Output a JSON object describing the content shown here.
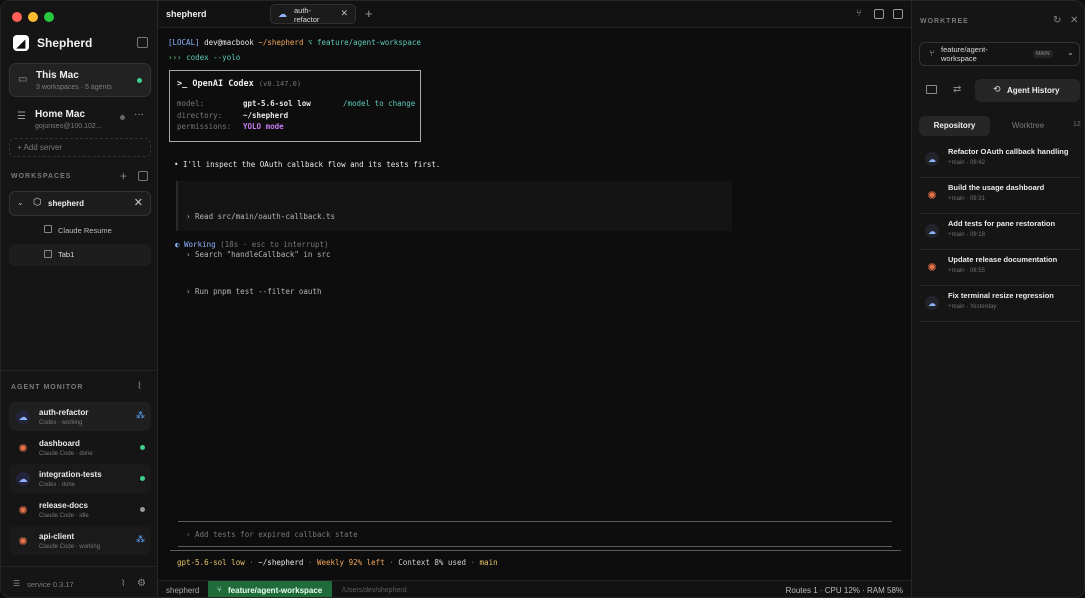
{
  "app": {
    "title": "shepherd"
  },
  "sidebar": {
    "brand": "Shepherd",
    "servers": [
      {
        "name": "This Mac",
        "sub": "3 workspaces · 5 agents",
        "status": "online"
      },
      {
        "name": "Home Mac",
        "sub": "gojunseo@100.102...",
        "status": "offline"
      }
    ],
    "add_server": "Add server",
    "workspaces_label": "WORKSPACES",
    "workspace": {
      "name": "shepherd",
      "items": [
        "Claude Resume",
        "Tab1"
      ]
    },
    "agent_monitor_label": "AGENT MONITOR",
    "agents": [
      {
        "name": "auth-refactor",
        "sub": "Codex · working",
        "kind": "codex",
        "state": "working"
      },
      {
        "name": "dashboard",
        "sub": "Claude Code · done",
        "kind": "claude",
        "state": "done"
      },
      {
        "name": "integration-tests",
        "sub": "Codex · done",
        "kind": "codex",
        "state": "done"
      },
      {
        "name": "release-docs",
        "sub": "Claude Code · idle",
        "kind": "claude",
        "state": "idle"
      },
      {
        "name": "api-client",
        "sub": "Claude Code · working",
        "kind": "claude",
        "state": "working"
      }
    ],
    "version": "service 0.3.17"
  },
  "main": {
    "title": "shepherd",
    "tab": {
      "label": "auth-refactor"
    },
    "terminal": {
      "prompt_tag": "[LOCAL]",
      "user_host": "dev@macbook",
      "path": "~/shepherd",
      "branch_glyph": "⌥",
      "branch": "feature/agent-workspace",
      "cmd_prefix": "›››",
      "command": "codex --yolo",
      "codex_box": {
        "header_prefix": ">_",
        "header": "OpenAI Codex",
        "version": "(v0.147.0)",
        "model_label": "model:",
        "model": "gpt-5.6-sol low",
        "model_hint": "/model to change",
        "dir_label": "directory:",
        "dir": "~/shepherd",
        "perm_label": "permissions:",
        "perm": "YOLO mode"
      },
      "message": "• I'll inspect the OAuth callback flow and its tests first.",
      "steps": [
        "› Read src/main/oauth-callback.ts",
        "› Search \"handleCallback\" in src",
        "› Run pnpm test --filter oauth"
      ],
      "working_glyph": "◐",
      "working": "Working",
      "working_hint": "(18s · esc to interrupt)",
      "input_placeholder": "› Add tests for expired callback state",
      "status": {
        "model": "gpt-5.6-sol low",
        "path": "~/shepherd",
        "weekly": "Weekly 92% left",
        "context": "Context 8% used",
        "branch": "main"
      }
    },
    "footer": {
      "left": "shepherd",
      "branch": "feature/agent-workspace",
      "path": "/Users/dev/shepherd",
      "right": "Routes 1 · CPU 12% · RAM 58%"
    }
  },
  "right": {
    "label": "WORKTREE",
    "branch": "feature/agent-workspace",
    "branch_badge": "MAIN",
    "history_button": "Agent History",
    "tabs": [
      "Repository",
      "Worktree"
    ],
    "count": "12",
    "history": [
      {
        "title": "Refactor OAuth callback handling",
        "branch": "main",
        "time": "09:42",
        "kind": "codex"
      },
      {
        "title": "Build the usage dashboard",
        "branch": "main",
        "time": "09:31",
        "kind": "claude"
      },
      {
        "title": "Add tests for pane restoration",
        "branch": "main",
        "time": "09:18",
        "kind": "codex"
      },
      {
        "title": "Update release documentation",
        "branch": "main",
        "time": "08:55",
        "kind": "claude"
      },
      {
        "title": "Fix terminal resize regression",
        "branch": "main",
        "time": "Yesterday",
        "kind": "codex"
      }
    ]
  },
  "colors": {
    "accent_green": "#3fcf8e",
    "branch_green": "#1f6b3a",
    "codex_blue": "#8fb3ff",
    "claude_orange": "#e8734a"
  }
}
